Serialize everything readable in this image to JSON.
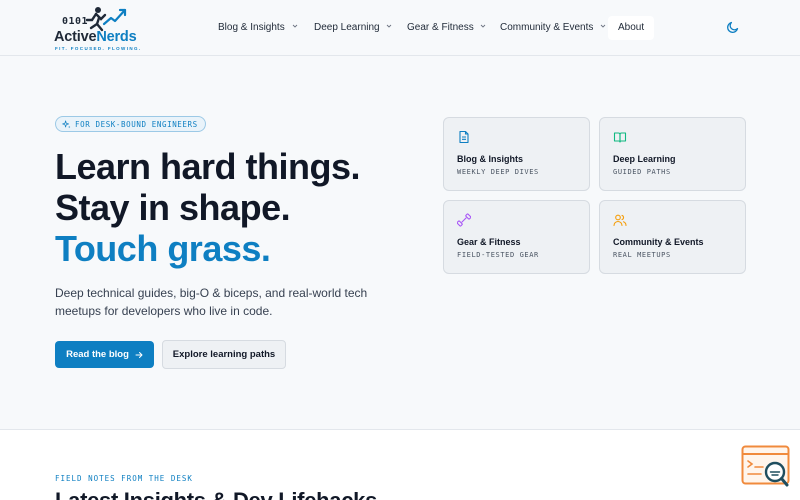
{
  "logo": {
    "binary": "0101",
    "name_part1": "Active",
    "name_part2": "Nerds",
    "tagline": "FIT. FOCUSED. FLOWING."
  },
  "nav": {
    "items": [
      {
        "label": "Blog & Insights",
        "has_dropdown": true
      },
      {
        "label": "Deep Learning",
        "has_dropdown": true
      },
      {
        "label": "Gear & Fitness",
        "has_dropdown": true
      },
      {
        "label": "Community & Events",
        "has_dropdown": true
      },
      {
        "label": "About",
        "has_dropdown": false
      }
    ],
    "theme_toggle_icon": "moon-icon"
  },
  "hero": {
    "pill": "FOR DESK-BOUND ENGINEERS",
    "headline_line1": "Learn hard things.",
    "headline_line2": "Stay in shape.",
    "headline_line3": "Touch grass.",
    "subtext": "Deep technical guides, big-O & biceps, and real-world tech meetups for developers who live in code.",
    "primary_button": "Read the blog",
    "secondary_button": "Explore learning paths"
  },
  "cards": [
    {
      "icon": "document-icon",
      "title": "Blog & Insights",
      "subtitle": "WEEKLY DEEP DIVES",
      "color": "#0e7fc2"
    },
    {
      "icon": "book-open-icon",
      "title": "Deep Learning",
      "subtitle": "GUIDED PATHS",
      "color": "#10b981"
    },
    {
      "icon": "dumbbell-icon",
      "title": "Gear & Fitness",
      "subtitle": "FIELD-TESTED GEAR",
      "color": "#a855f7"
    },
    {
      "icon": "users-icon",
      "title": "Community & Events",
      "subtitle": "REAL MEETUPS",
      "color": "#f59e0b"
    }
  ],
  "latest": {
    "eyebrow": "FIELD NOTES FROM THE DESK",
    "title": "Latest Insights & Dev Lifehacks"
  },
  "colors": {
    "accent": "#0e7fc2",
    "background": "#f7f9fb",
    "card_bg": "#eef1f4"
  }
}
